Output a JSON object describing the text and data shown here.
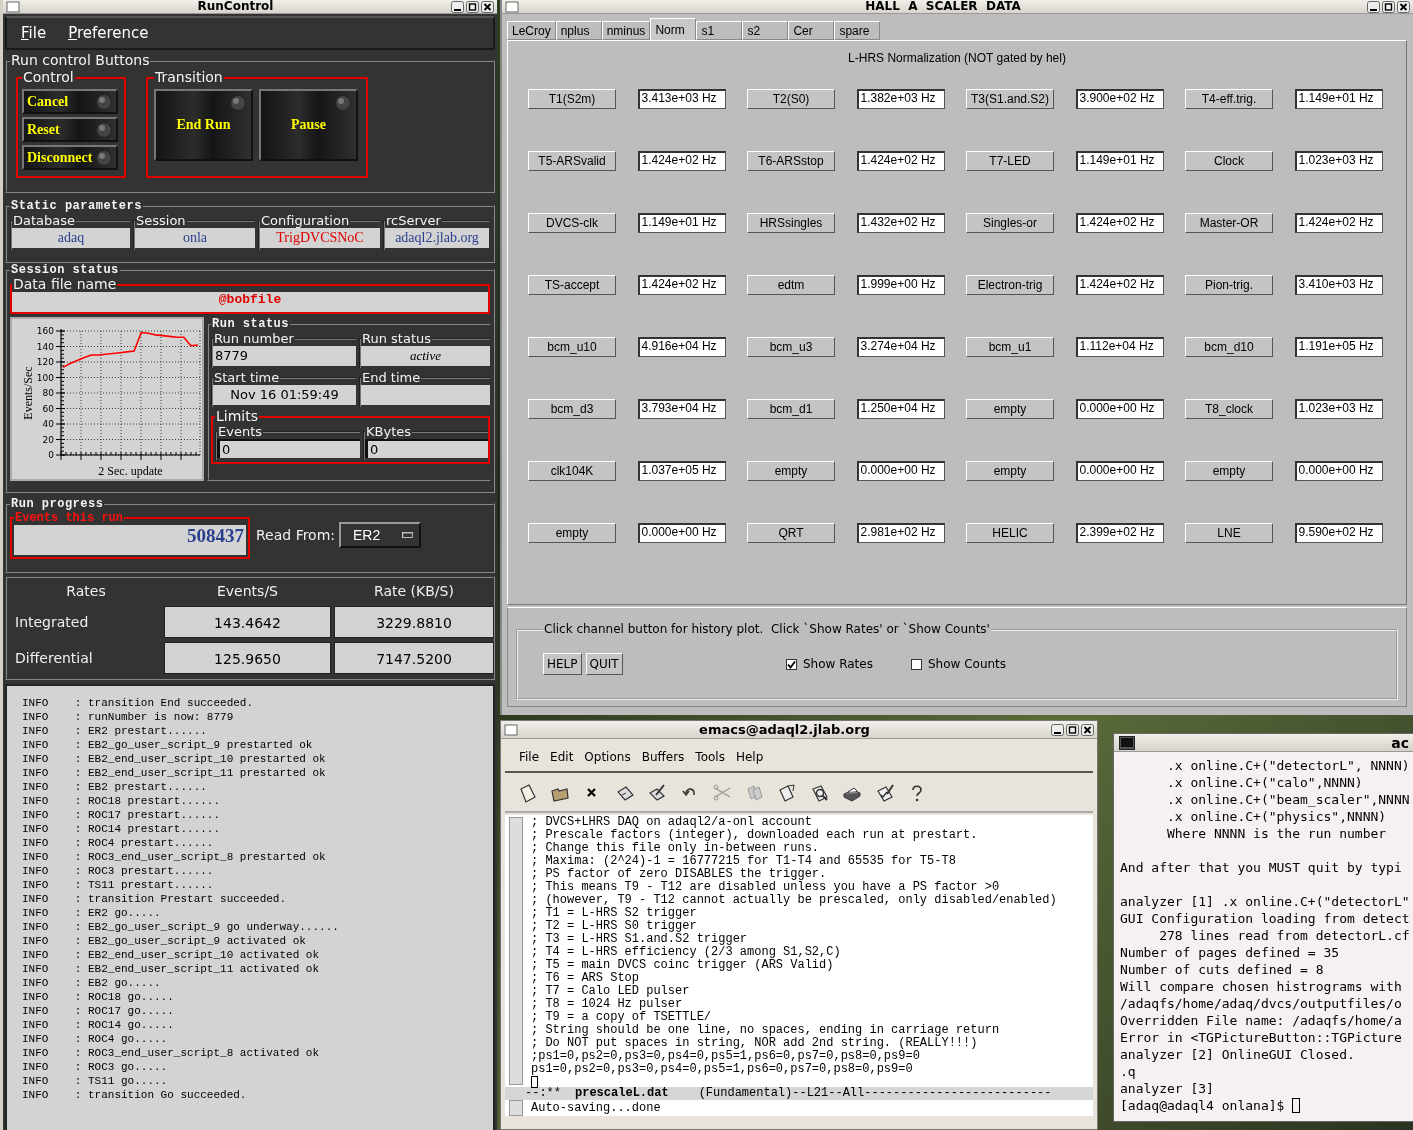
{
  "run_control": {
    "window": {
      "title": "RunControl"
    },
    "menu": [
      "File",
      "Preference"
    ],
    "buttons_group": {
      "title": "Run control Buttons",
      "control": {
        "title": "Control",
        "buttons": [
          "Cancel",
          "Reset",
          "Disconnect"
        ]
      },
      "transition": {
        "title": "Transition",
        "buttons": [
          "End Run",
          "Pause"
        ]
      }
    },
    "static_parameters": {
      "title": "Static parameters",
      "fields": [
        {
          "label": "Database",
          "value": "adaq",
          "color": "#2b3f8f"
        },
        {
          "label": "Session",
          "value": "onla",
          "color": "#2b3f8f"
        },
        {
          "label": "Configuration",
          "value": "TrigDVCSNoC",
          "color": "#e00000"
        },
        {
          "label": "rcServer",
          "value": "adaql2.jlab.org",
          "color": "#2b3f8f"
        }
      ]
    },
    "session_status": {
      "title": "Session status",
      "data_file": {
        "label": "Data file name",
        "value": "@bobfile"
      },
      "chart_data": {
        "type": "line",
        "grid": true,
        "xlabel": "2 Sec. update",
        "ylabel": "Events/Sec",
        "ylim": [
          0,
          160
        ],
        "yticks": [
          0,
          20,
          40,
          60,
          80,
          100,
          120,
          140,
          160
        ],
        "values": [
          113,
          118,
          122,
          126,
          129,
          129,
          130,
          131,
          132,
          133,
          134,
          158,
          157,
          155,
          154,
          153,
          152,
          152,
          141,
          142
        ]
      },
      "run_status": {
        "title": "Run status",
        "fields": [
          {
            "label": "Run number",
            "value": "8779"
          },
          {
            "label": "Run status",
            "value": "active"
          },
          {
            "label": "Start time",
            "value": "Nov 16 01:59:49"
          },
          {
            "label": "End time"
          }
        ],
        "limits": {
          "title": "Limits",
          "fields": [
            {
              "label": "Events",
              "value": "0"
            },
            {
              "label": "KBytes",
              "value": "0"
            }
          ]
        }
      }
    },
    "run_progress": {
      "title": "Run progress",
      "events": {
        "label": "Events this run",
        "value": "508437"
      },
      "read_from": {
        "label": "Read From:",
        "value": "ER2"
      }
    },
    "rates": {
      "columns": [
        "Rates",
        "Events/S",
        "Rate (KB/S)"
      ],
      "rows": [
        {
          "label": "Integrated",
          "values": [
            "143.4642",
            "3229.8810"
          ]
        },
        {
          "label": "Differential",
          "values": [
            "125.9650",
            "7147.5200"
          ]
        }
      ]
    },
    "log": [
      "INFO    : transition End succeeded.",
      "INFO    : runNumber is now: 8779",
      "INFO    : ER2 prestart......",
      "INFO    : EB2_go_user_script_9 prestarted ok",
      "INFO    : EB2_end_user_script_10 prestarted ok",
      "INFO    : EB2_end_user_script_11 prestarted ok",
      "INFO    : EB2 prestart......",
      "INFO    : ROC18 prestart......",
      "INFO    : ROC17 prestart......",
      "INFO    : ROC14 prestart......",
      "INFO    : ROC4 prestart......",
      "INFO    : ROC3_end_user_script_8 prestarted ok",
      "INFO    : ROC3 prestart......",
      "INFO    : TS11 prestart......",
      "INFO    : transition Prestart succeeded.",
      "INFO    : ER2 go.....",
      "INFO    : EB2_go_user_script_9 go underway......",
      "INFO    : EB2_go_user_script_9 activated ok",
      "INFO    : EB2_end_user_script_10 activated ok",
      "INFO    : EB2_end_user_script_11 activated ok",
      "INFO    : EB2 go.....",
      "INFO    : ROC18 go.....",
      "INFO    : ROC17 go.....",
      "INFO    : ROC14 go.....",
      "INFO    : ROC4 go.....",
      "INFO    : ROC3_end_user_script_8 activated ok",
      "INFO    : ROC3 go.....",
      "INFO    : TS11 go.....",
      "INFO    : transition Go succeeded."
    ]
  },
  "scaler": {
    "window": {
      "title": "HALL  A  SCALER  DATA"
    },
    "tabs": [
      {
        "label": "LeCroy",
        "selected": false
      },
      {
        "label": "nplus",
        "selected": false
      },
      {
        "label": "nminus",
        "selected": false
      },
      {
        "label": "Norm",
        "selected": true
      },
      {
        "label": "s1",
        "selected": false
      },
      {
        "label": "s2",
        "selected": false
      },
      {
        "label": "Cer",
        "selected": false
      },
      {
        "label": "spare",
        "selected": false
      }
    ],
    "heading": "L-HRS Normalization (NOT gated by hel)",
    "channels": [
      {
        "name": "T1(S2m)",
        "rate": "3.413e+03 Hz"
      },
      {
        "name": "T2(S0)",
        "rate": "1.382e+03 Hz"
      },
      {
        "name": "T3(S1.and.S2)",
        "rate": "3.900e+02 Hz"
      },
      {
        "name": "T4-eff.trig.",
        "rate": "1.149e+01 Hz"
      },
      {
        "name": "T5-ARSvalid",
        "rate": "1.424e+02 Hz"
      },
      {
        "name": "T6-ARSstop",
        "rate": "1.424e+02 Hz"
      },
      {
        "name": "T7-LED",
        "rate": "1.149e+01 Hz"
      },
      {
        "name": "Clock",
        "rate": "1.023e+03 Hz"
      },
      {
        "name": "DVCS-clk",
        "rate": "1.149e+01 Hz"
      },
      {
        "name": "HRSsingles",
        "rate": "1.432e+02 Hz"
      },
      {
        "name": "Singles-or",
        "rate": "1.424e+02 Hz"
      },
      {
        "name": "Master-OR",
        "rate": "1.424e+02 Hz"
      },
      {
        "name": "TS-accept",
        "rate": "1.424e+02 Hz"
      },
      {
        "name": "edtm",
        "rate": "1.999e+00 Hz"
      },
      {
        "name": "Electron-trig",
        "rate": "1.424e+02 Hz"
      },
      {
        "name": "Pion-trig.",
        "rate": "3.410e+03 Hz"
      },
      {
        "name": "bcm_u10",
        "rate": "4.916e+04 Hz"
      },
      {
        "name": "bcm_u3",
        "rate": "3.274e+04 Hz"
      },
      {
        "name": "bcm_u1",
        "rate": "1.112e+04 Hz"
      },
      {
        "name": "bcm_d10",
        "rate": "1.191e+05 Hz"
      },
      {
        "name": "bcm_d3",
        "rate": "3.793e+04 Hz"
      },
      {
        "name": "bcm_d1",
        "rate": "1.250e+04 Hz"
      },
      {
        "name": "empty",
        "rate": "0.000e+00 Hz"
      },
      {
        "name": "T8_clock",
        "rate": "1.023e+03 Hz"
      },
      {
        "name": "clk104K",
        "rate": "1.037e+05 Hz"
      },
      {
        "name": "empty",
        "rate": "0.000e+00 Hz"
      },
      {
        "name": "empty",
        "rate": "0.000e+00 Hz"
      },
      {
        "name": "empty",
        "rate": "0.000e+00 Hz"
      },
      {
        "name": "empty",
        "rate": "0.000e+00 Hz"
      },
      {
        "name": "QRT",
        "rate": "2.981e+02 Hz"
      },
      {
        "name": "HELIC",
        "rate": "2.399e+02 Hz"
      },
      {
        "name": "LNE",
        "rate": "9.590e+02 Hz"
      }
    ],
    "footer": {
      "hint": "Click channel button for history plot.  Click `Show Rates' or `Show Counts'",
      "buttons": [
        "HELP",
        "QUIT"
      ],
      "options": [
        {
          "label": "Show Rates",
          "checked": true
        },
        {
          "label": "Show Counts",
          "checked": false
        }
      ]
    }
  },
  "emacs": {
    "window": {
      "title": "emacs@adaql2.jlab.org"
    },
    "menu": [
      "File",
      "Edit",
      "Options",
      "Buffers",
      "Tools",
      "Help"
    ],
    "lines": [
      "; DVCS+LHRS DAQ on adaql2/a-onl account",
      "; Prescale factors (integer), downloaded each run at prestart.",
      "; Change this file only in-between runs.",
      "; Maxima: (2^24)-1 = 16777215 for T1-T4 and 65535 for T5-T8",
      "; PS factor of zero DISABLES the trigger.",
      "; This means T9 - T12 are disabled unless you have a PS factor >0",
      "; (however, T9 - T12 cannot actually be prescaled, only disabled/enabled)",
      "; T1 = L-HRS S2 trigger",
      "; T2 = L-HRS S0 trigger",
      "; T3 = L-HRS S1.and.S2 trigger",
      "; T4 = L-HRS efficiency (2/3 among S1,S2,C)",
      "; T5 = main DVCS coinc trigger (ARS Valid)",
      "; T6 = ARS Stop",
      "; T7 = Calo LED pulser",
      "; T8 = 1024 Hz pulser",
      "; T9 = a copy of TSETTLE/",
      "; String should be one line, no spaces, ending in carriage return",
      "; Do NOT put spaces in string, NOR add 2nd string. (REALLY!!!)",
      ";ps1=0,ps2=0,ps3=0,ps4=0,ps5=1,ps6=0,ps7=0,ps8=0,ps9=0",
      "ps1=0,ps2=0,ps3=0,ps4=0,ps5=1,ps6=0,ps7=0,ps8=0,ps9=0"
    ],
    "mode_line": {
      "status": "--:**",
      "buffer": "prescaleL.dat",
      "info": "(Fundamental)--L21--All--------------------------"
    },
    "echo": "Auto-saving...done"
  },
  "terminal": {
    "window": {
      "title": "ac"
    },
    "blocks": [
      [
        "      .x online.C+(\"detectorL\", NNNN)",
        "      .x online.C+(\"calo\",NNNN)",
        "      .x online.C+(\"beam_scaler\",NNNN",
        "      .x online.C+(\"physics\",NNNN)",
        "      Where NNNN is the run number"
      ],
      [
        "And after that you MUST quit by typi"
      ],
      [
        "analyzer [1] .x online.C+(\"detectorL\"",
        "GUI Configuration loading from detect",
        "     278 lines read from detectorL.cf",
        "Number of pages defined = 35",
        "Number of cuts defined = 8",
        "Will compare chosen histrograms with",
        "/adaqfs/home/adaq/dvcs/outputfiles/o",
        "Overridden File name: /adaqfs/home/a",
        "Error in <TGPictureButton::TGPicture",
        "analyzer [2] OnlineGUI Closed.",
        ".q",
        "analyzer [3]",
        "[adaq@adaql4 onlana]$"
      ]
    ]
  }
}
